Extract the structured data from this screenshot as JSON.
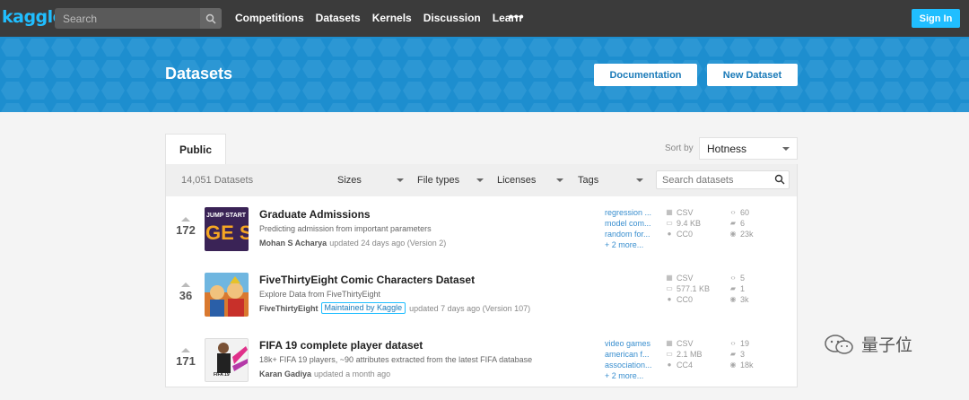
{
  "nav": {
    "logo": "kaggle",
    "search_placeholder": "Search",
    "links": [
      "Competitions",
      "Datasets",
      "Kernels",
      "Discussion",
      "Learn"
    ],
    "more": "•••",
    "signin": "Sign In"
  },
  "banner": {
    "title": "Datasets",
    "documentation": "Documentation",
    "new_dataset": "New Dataset"
  },
  "tabs": {
    "public": "Public",
    "sort_by_label": "Sort by",
    "sort_value": "Hotness"
  },
  "filters": {
    "count": "14,051 Datasets",
    "sizes": "Sizes",
    "file_types": "File types",
    "licenses": "Licenses",
    "tags": "Tags",
    "search_placeholder": "Search datasets"
  },
  "datasets": [
    {
      "votes": "172",
      "title": "Graduate Admissions",
      "subtitle": "Predicting admission from important parameters",
      "owner": "Mohan S Acharya",
      "maintained": "",
      "updated": "updated 24 days ago (Version 2)",
      "tags": [
        "regression ...",
        "model com...",
        "random for...",
        "+ 2 more..."
      ],
      "file_type": "CSV",
      "size": "9.4 KB",
      "license": "CC0",
      "kernels": "60",
      "comments": "6",
      "views": "23k",
      "thumb_text_1": "JUMP START",
      "thumb_text_2": "GE SE"
    },
    {
      "votes": "36",
      "title": "FiveThirtyEight Comic Characters Dataset",
      "subtitle": "Explore Data from FiveThirtyEight",
      "owner": "FiveThirtyEight",
      "maintained": "Maintained by Kaggle",
      "updated": "updated 7 days ago (Version 107)",
      "tags": [],
      "file_type": "CSV",
      "size": "577.1 KB",
      "license": "CC0",
      "kernels": "5",
      "comments": "1",
      "views": "3k"
    },
    {
      "votes": "171",
      "title": "FIFA 19 complete player dataset",
      "subtitle": "18k+ FIFA 19 players, ~90 attributes extracted from the latest FIFA database",
      "owner": "Karan Gadiya",
      "maintained": "",
      "updated": "updated a month ago",
      "tags": [
        "video games",
        "american f...",
        "association...",
        "+ 2 more..."
      ],
      "file_type": "CSV",
      "size": "2.1 MB",
      "license": "CC4",
      "kernels": "19",
      "comments": "3",
      "views": "18k",
      "thumb_text_1": "FIFA 19"
    }
  ],
  "watermark": "量子位",
  "colors": {
    "nav_bg": "#3b3b3b",
    "accent": "#20beff",
    "banner": "#1d8ecf",
    "tag_link": "#3a8fcf"
  }
}
